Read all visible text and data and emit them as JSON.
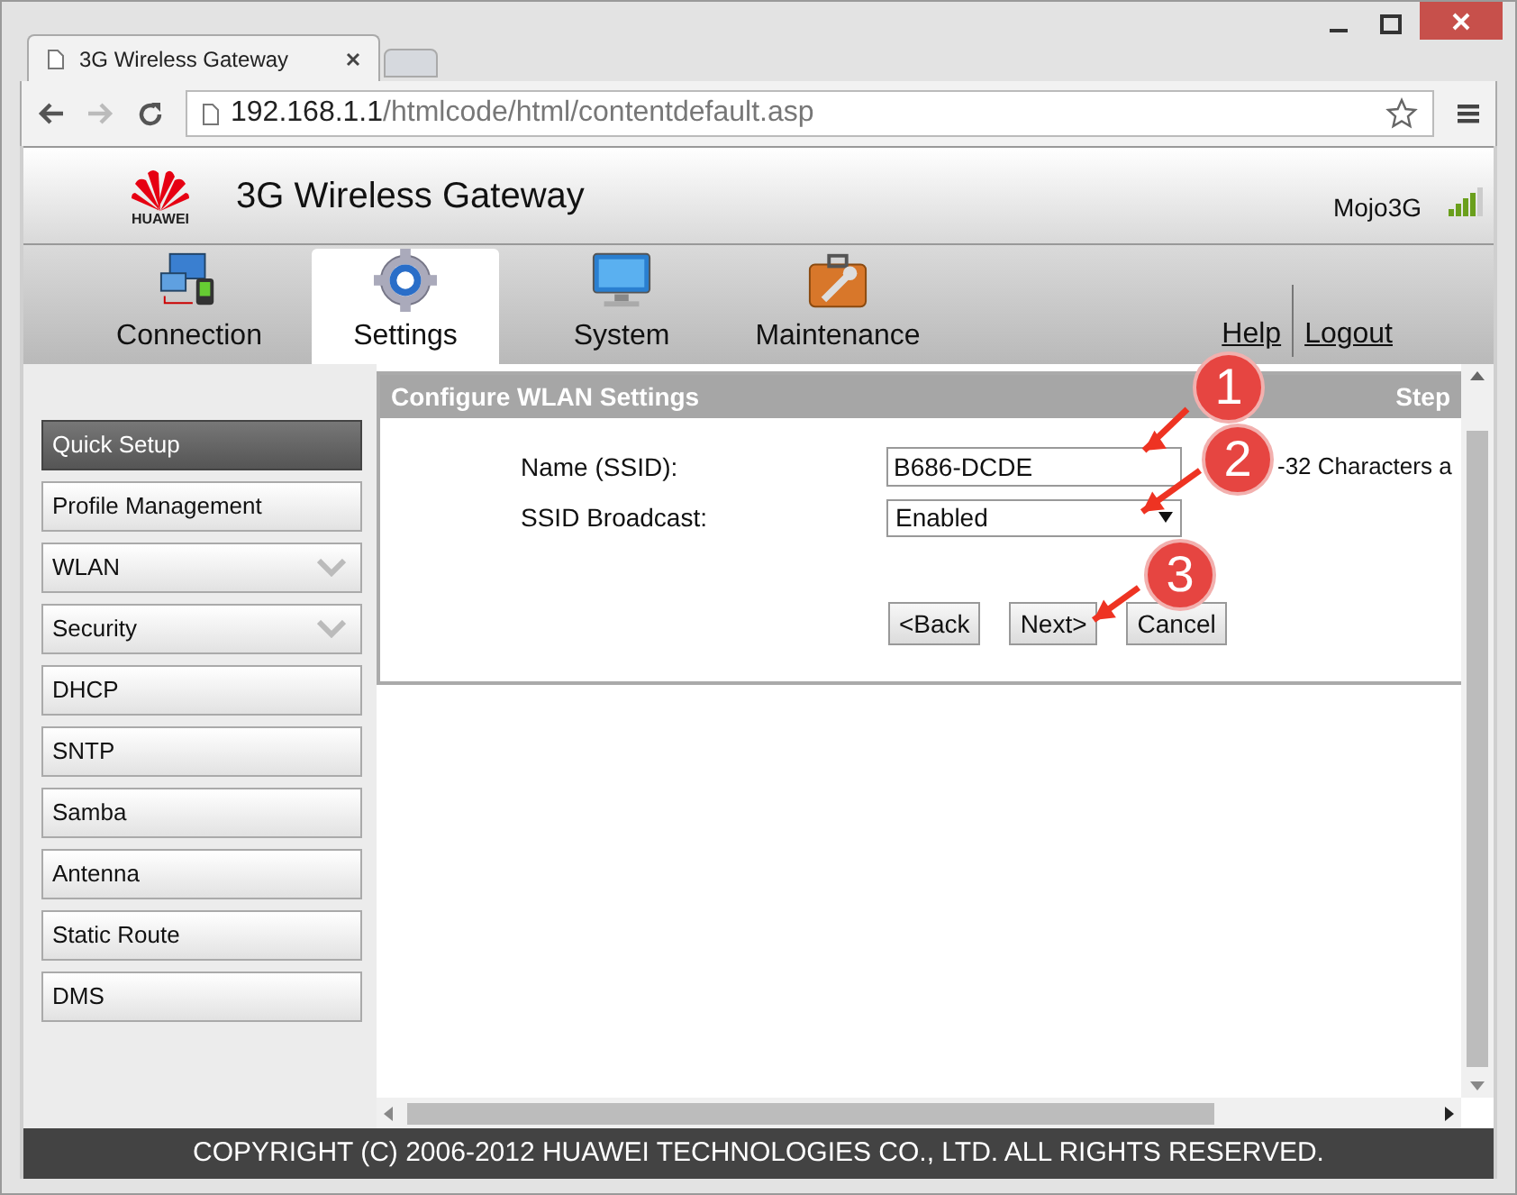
{
  "browser": {
    "tab_title": "3G Wireless Gateway",
    "url_host": "192.168.1.1",
    "url_path": "/htmlcode/html/contentdefault.asp"
  },
  "header": {
    "logo_text": "HUAWEI",
    "title": "3G Wireless Gateway",
    "network": "Mojo3G"
  },
  "nav": [
    {
      "label": "Connection",
      "kind": "connection",
      "selected": false
    },
    {
      "label": "Settings",
      "kind": "settings",
      "selected": true
    },
    {
      "label": "System",
      "kind": "system",
      "selected": false
    },
    {
      "label": "Maintenance",
      "kind": "maintenance",
      "selected": false
    }
  ],
  "links": [
    "Help",
    "Logout"
  ],
  "sidebar": {
    "items": [
      {
        "label": "Quick Setup",
        "selected": true
      },
      {
        "label": "Profile Management",
        "selected": false
      },
      {
        "label": "WLAN",
        "selected": false,
        "expandable": true
      },
      {
        "label": "Security",
        "selected": false,
        "expandable": true
      },
      {
        "label": "DHCP",
        "selected": false
      },
      {
        "label": "SNTP",
        "selected": false
      },
      {
        "label": "Samba",
        "selected": false
      },
      {
        "label": "Antenna",
        "selected": false
      },
      {
        "label": "Static Route",
        "selected": false
      },
      {
        "label": "DMS",
        "selected": false
      }
    ]
  },
  "panel": {
    "title": "Configure WLAN Settings",
    "step": "Step",
    "fields": [
      {
        "label": "Name (SSID):",
        "kind": "text",
        "value": "B686-DCDE",
        "hint": "-32 Characters a"
      },
      {
        "label": "SSID Broadcast:",
        "kind": "select",
        "value": "Enabled"
      }
    ],
    "buttons": [
      "<Back",
      "Next>",
      "Cancel"
    ]
  },
  "annotations": [
    {
      "number": "1"
    },
    {
      "number": "2"
    },
    {
      "number": "3"
    }
  ],
  "footer": "COPYRIGHT (C) 2006-2012 HUAWEI TECHNOLOGIES CO., LTD. ALL RIGHTS RESERVED."
}
